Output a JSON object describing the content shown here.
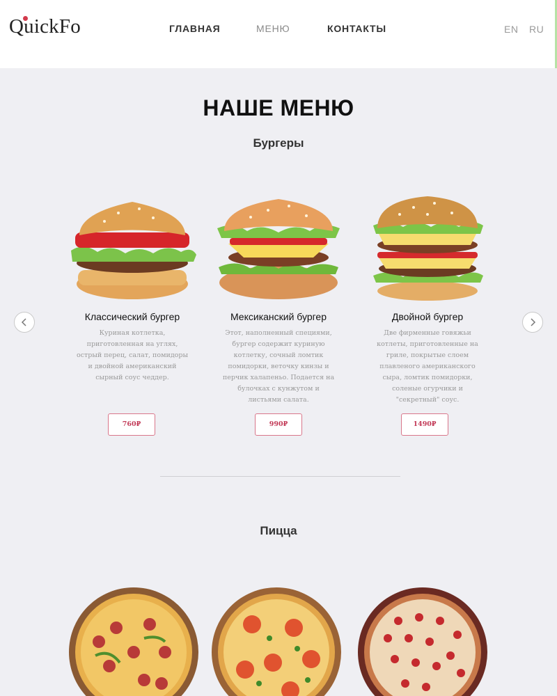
{
  "header": {
    "logo": "QuickFo",
    "nav": [
      "ГЛАВНАЯ",
      "МЕНЮ",
      "КОНТАКТЫ"
    ],
    "lang": [
      "EN",
      "RU"
    ]
  },
  "page": {
    "title": "НАШЕ МЕНЮ"
  },
  "sections": {
    "burgers_title": "Бургеры",
    "pizza_title": "Пицца"
  },
  "burgers": [
    {
      "name": "Классический бургер",
      "desc": [
        "Куриная котлетка,",
        "приготовленная на углях,",
        "острый перец, салат, помидоры",
        "и двойной американский",
        "сырный соус чеддер."
      ],
      "price": "760₽"
    },
    {
      "name": "Мексиканский бургер",
      "desc": [
        "Этот, наполненный специями,",
        "бургер содержит куриную",
        "котлетку, сочный ломтик",
        "помидорки, веточку кинзы и",
        "перчик халапеньо. Подается на",
        "булочках с кунжутом и",
        "листьями салата."
      ],
      "price": "990₽"
    },
    {
      "name": "Двойной бургер",
      "desc": [
        "Две фирменные говяжьи",
        "котлеты, приготовленные на",
        "гриле, покрытые слоем",
        "плавленого американского",
        "сыра, ломтик помидорки,",
        "соленые огурчики и",
        "\"секретный\" соус."
      ],
      "price": "1490₽"
    }
  ],
  "icons": {
    "prev": "chevron-left-icon",
    "next": "chevron-right-icon"
  },
  "colors": {
    "accent": "#c23a57",
    "background": "#efeff3"
  }
}
